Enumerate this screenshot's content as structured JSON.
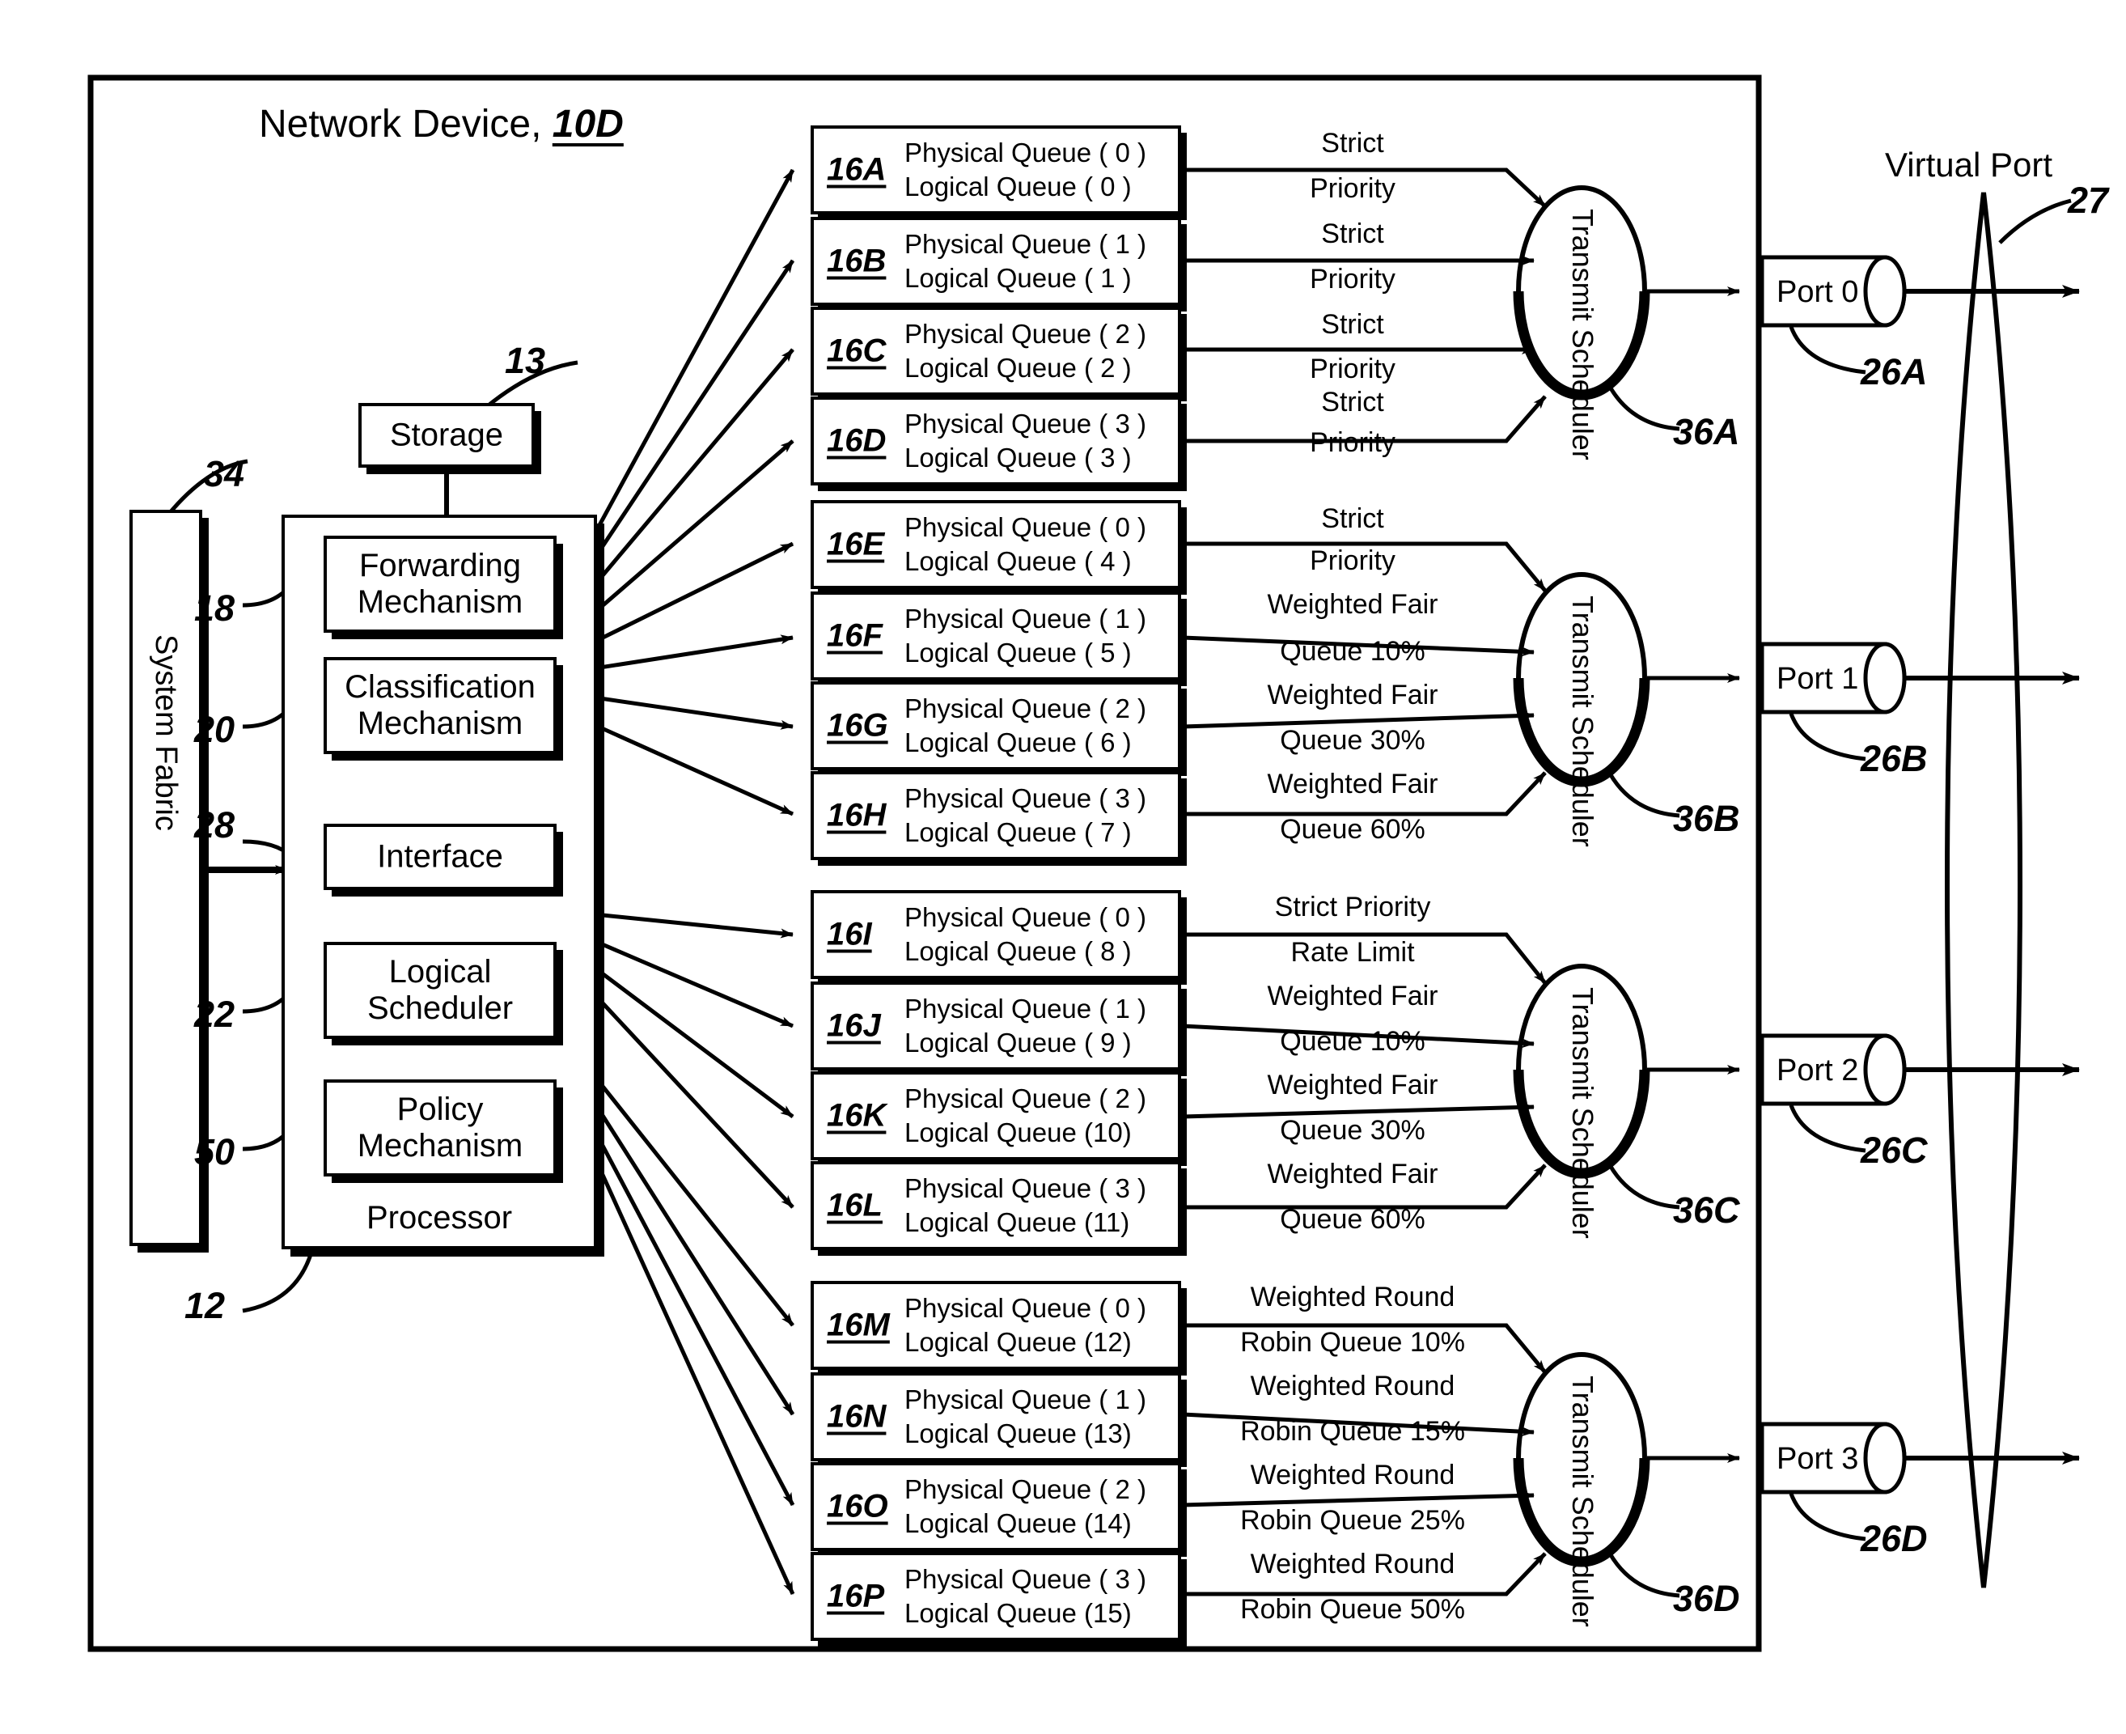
{
  "figure": {
    "title_text": "Network Device,",
    "title_ref": "10D",
    "outer_frame_name": "network-device-boundary"
  },
  "left": {
    "system_fabric": "System Fabric",
    "system_fabric_ref": "34",
    "storage": "Storage",
    "storage_ref": "13",
    "processor": "Processor",
    "processor_ref": "12",
    "modules": [
      {
        "label": "Forwarding Mechanism",
        "ref": "18"
      },
      {
        "label": "Classification Mechanism",
        "ref": "20"
      },
      {
        "label": "Interface",
        "ref": "28"
      },
      {
        "label": "Logical Scheduler",
        "ref": "22"
      },
      {
        "label": "Policy Mechanism",
        "ref": "50"
      }
    ]
  },
  "queue_groups": [
    {
      "id": "group-a",
      "scheduler_label": "Transmit Scheduler",
      "scheduler_ref": "36A",
      "port_label": "Port 0",
      "port_ref": "26A",
      "queues": [
        {
          "ref": "16A",
          "physical": "Physical Queue ( 0 )",
          "logical": "Logical Queue ( 0 )",
          "policy_line1": "Strict",
          "policy_line2": "Priority"
        },
        {
          "ref": "16B",
          "physical": "Physical Queue ( 1 )",
          "logical": "Logical Queue ( 1 )",
          "policy_line1": "Strict",
          "policy_line2": "Priority"
        },
        {
          "ref": "16C",
          "physical": "Physical Queue ( 2 )",
          "logical": "Logical Queue ( 2 )",
          "policy_line1": "Strict",
          "policy_line2": "Priority"
        },
        {
          "ref": "16D",
          "physical": "Physical Queue ( 3 )",
          "logical": "Logical Queue ( 3 )",
          "policy_line1": "Strict",
          "policy_line2": "Priority"
        }
      ]
    },
    {
      "id": "group-b",
      "scheduler_label": "Transmit Scheduler",
      "scheduler_ref": "36B",
      "port_label": "Port 1",
      "port_ref": "26B",
      "queues": [
        {
          "ref": "16E",
          "physical": "Physical Queue ( 0 )",
          "logical": "Logical Queue ( 4 )",
          "policy_line1": "Strict",
          "policy_line2": "Priority"
        },
        {
          "ref": "16F",
          "physical": "Physical Queue ( 1 )",
          "logical": "Logical Queue ( 5 )",
          "policy_line1": "Weighted Fair",
          "policy_line2": "Queue 10%"
        },
        {
          "ref": "16G",
          "physical": "Physical Queue ( 2 )",
          "logical": "Logical Queue ( 6 )",
          "policy_line1": "Weighted Fair",
          "policy_line2": "Queue 30%"
        },
        {
          "ref": "16H",
          "physical": "Physical Queue ( 3 )",
          "logical": "Logical Queue ( 7 )",
          "policy_line1": "Weighted Fair",
          "policy_line2": "Queue 60%"
        }
      ]
    },
    {
      "id": "group-c",
      "scheduler_label": "Transmit Scheduler",
      "scheduler_ref": "36C",
      "port_label": "Port 2",
      "port_ref": "26C",
      "queues": [
        {
          "ref": "16I",
          "physical": "Physical Queue ( 0 )",
          "logical": "Logical Queue ( 8 )",
          "policy_line1": "Strict Priority",
          "policy_line2": "Rate Limit"
        },
        {
          "ref": "16J",
          "physical": "Physical Queue ( 1 )",
          "logical": "Logical Queue ( 9 )",
          "policy_line1": "Weighted Fair",
          "policy_line2": "Queue 10%"
        },
        {
          "ref": "16K",
          "physical": "Physical Queue ( 2 )",
          "logical": "Logical Queue (10)",
          "policy_line1": "Weighted Fair",
          "policy_line2": "Queue 30%"
        },
        {
          "ref": "16L",
          "physical": "Physical Queue ( 3 )",
          "logical": "Logical Queue (11)",
          "policy_line1": "Weighted Fair",
          "policy_line2": "Queue 60%"
        }
      ]
    },
    {
      "id": "group-d",
      "scheduler_label": "Transmit Scheduler",
      "scheduler_ref": "36D",
      "port_label": "Port 3",
      "port_ref": "26D",
      "queues": [
        {
          "ref": "16M",
          "physical": "Physical Queue ( 0 )",
          "logical": "Logical Queue (12)",
          "policy_line1": "Weighted Round",
          "policy_line2": "Robin Queue 10%"
        },
        {
          "ref": "16N",
          "physical": "Physical Queue ( 1 )",
          "logical": "Logical Queue (13)",
          "policy_line1": "Weighted Round",
          "policy_line2": "Robin Queue 15%"
        },
        {
          "ref": "16O",
          "physical": "Physical Queue ( 2 )",
          "logical": "Logical Queue (14)",
          "policy_line1": "Weighted Round",
          "policy_line2": "Robin Queue 25%"
        },
        {
          "ref": "16P",
          "physical": "Physical Queue ( 3 )",
          "logical": "Logical Queue (15)",
          "policy_line1": "Weighted Round",
          "policy_line2": "Robin Queue 50%"
        }
      ]
    }
  ],
  "virtual_port": {
    "label": "Virtual Port",
    "ref": "27"
  },
  "colors": {
    "ink": "#000000",
    "paper": "#ffffff"
  }
}
